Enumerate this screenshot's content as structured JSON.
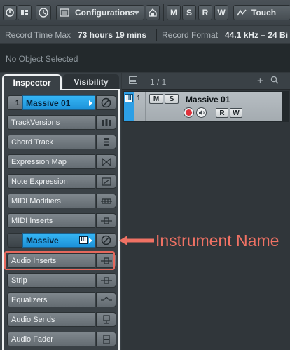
{
  "toolbar": {
    "configurations_label": "Configurations",
    "m_label": "M",
    "s_label": "S",
    "r_label": "R",
    "w_label": "W",
    "touch_label": "Touch"
  },
  "info": {
    "record_time_label": "Record Time Max",
    "record_time_value": "73 hours 19 mins",
    "record_format_label": "Record Format",
    "record_format_value": "44.1 kHz – 24 Bi"
  },
  "status": {
    "text": "No Object Selected"
  },
  "inspector": {
    "tab_inspector": "Inspector",
    "tab_visibility": "Visibility",
    "track_number": "1",
    "track_name": "Massive 01",
    "sections": [
      "TrackVersions",
      "Chord Track",
      "Expression Map",
      "Note Expression",
      "MIDI Modifiers",
      "MIDI Inserts"
    ],
    "instrument_name": "Massive",
    "audio_sections": [
      "Audio Inserts",
      "Strip",
      "Equalizers",
      "Audio Sends",
      "Audio Fader"
    ]
  },
  "tracklist": {
    "count": "1 / 1",
    "track": {
      "number": "1",
      "name": "Massive 01",
      "m": "M",
      "s": "S",
      "r": "R",
      "w": "W"
    }
  },
  "annotation": {
    "text": "Instrument Name"
  },
  "colors": {
    "accent": "#2c9fe6",
    "highlight": "#e5685c",
    "record": "#e0313b"
  }
}
